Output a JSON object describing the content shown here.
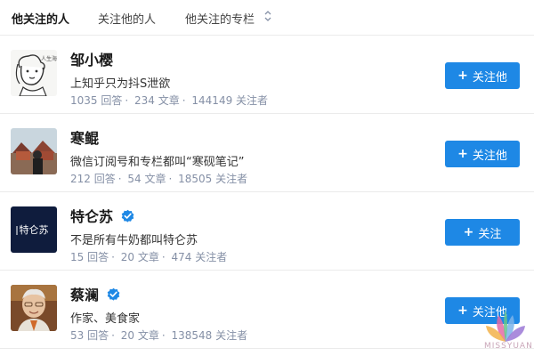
{
  "tabs": [
    {
      "label": "他关注的人",
      "active": true
    },
    {
      "label": "关注他的人",
      "active": false
    },
    {
      "label": "他关注的专栏",
      "active": false
    }
  ],
  "colors": {
    "accent": "#1e88e5",
    "verified": "#1e88e5",
    "stats": "#8590a6"
  },
  "users": [
    {
      "name": "邹小樱",
      "verified": false,
      "bio": "上知乎只为抖S泄欲",
      "answers": "1035 回答",
      "articles": "234 文章",
      "followers": "144149 关注者",
      "button": "关注他",
      "avatar_text": "人生海海"
    },
    {
      "name": "寒鲲",
      "verified": false,
      "bio": "微信订阅号和专栏都叫“寒砚笔记”",
      "answers": "212 回答",
      "articles": "54 文章",
      "followers": "18505 关注者",
      "button": "关注他"
    },
    {
      "name": "特仑苏",
      "verified": true,
      "bio": "不是所有牛奶都叫特仑苏",
      "answers": "15 回答",
      "articles": "20 文章",
      "followers": "474 关注者",
      "button": "关注",
      "avatar_text": "特仑苏"
    },
    {
      "name": "蔡澜",
      "verified": true,
      "bio": "作家、美食家",
      "answers": "53 回答",
      "articles": "20 文章",
      "followers": "138548 关注者",
      "button": "关注他"
    }
  ],
  "watermark": {
    "text": "MISSYUAN"
  }
}
